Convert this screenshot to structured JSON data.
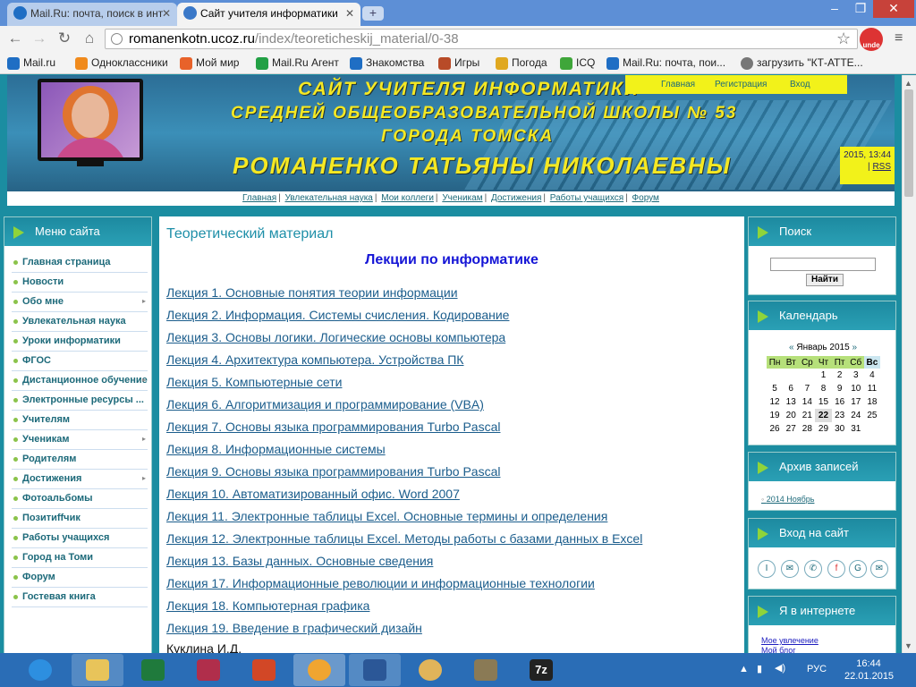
{
  "browser": {
    "tabs": [
      {
        "label": "Mail.Ru: почта, поиск в инт",
        "active": false
      },
      {
        "label": "Сайт учителя информатики",
        "active": true
      }
    ],
    "url_host": "romanenkotn.ucoz.ru",
    "url_path": "/index/teoreticheskij_material/0-38",
    "extension_label": "unde",
    "window_controls": {
      "minimize": "–",
      "restore": "❐",
      "close": "✕"
    }
  },
  "bookmarks": [
    {
      "label": "Mail.ru",
      "icon": "mailru-icon",
      "color": "#1f6ec4"
    },
    {
      "label": "Одноклассники",
      "icon": "odnoklassniki-icon",
      "color": "#f08a1c"
    },
    {
      "label": "Мой мир",
      "icon": "moimir-icon",
      "color": "#e8622a"
    },
    {
      "label": "Mail.Ru Агент",
      "icon": "agent-icon",
      "color": "#22a045"
    },
    {
      "label": "Знакомства",
      "icon": "znakomstva-icon",
      "color": "#1f6ec4"
    },
    {
      "label": "Игры",
      "icon": "games-icon",
      "color": "#b84b28"
    },
    {
      "label": "Погода",
      "icon": "weather-icon",
      "color": "#e0a820"
    },
    {
      "label": "ICQ",
      "icon": "icq-icon",
      "color": "#3fa63a"
    },
    {
      "label": "Mail.Ru: почта, пои...",
      "icon": "mailru-icon",
      "color": "#1f6ec4"
    },
    {
      "label": "загрузить \"КТ-АТТЕ...",
      "icon": "globe-icon",
      "color": "#777777"
    }
  ],
  "banner": {
    "line1": "Сайт учителя информатики",
    "line2": "средней общеобразовательной школы № 53",
    "line3": "города Томска",
    "line4": "Романенко Татьяны Николаевны",
    "top_menu": [
      "Главная",
      "Регистрация",
      "Вход"
    ],
    "date_text": "2015, 13:44",
    "rss": "RSS"
  },
  "navline": [
    "Главная",
    "Увлекательная наука",
    "Мои коллеги",
    "Ученикам",
    "Достижения",
    "Работы учащихся",
    "Форум"
  ],
  "left_menu": {
    "title": "Меню сайта",
    "items": [
      {
        "label": "Главная страница",
        "sub": false
      },
      {
        "label": "Новости",
        "sub": false
      },
      {
        "label": "Обо мне",
        "sub": true
      },
      {
        "label": "Увлекательная наука",
        "sub": false
      },
      {
        "label": "Уроки информатики",
        "sub": false
      },
      {
        "label": "ФГОС",
        "sub": false
      },
      {
        "label": "Дистанционное обучение",
        "sub": true
      },
      {
        "label": "Электронные ресурсы ...",
        "sub": false
      },
      {
        "label": "Учителям",
        "sub": false
      },
      {
        "label": "Ученикам",
        "sub": true
      },
      {
        "label": "Родителям",
        "sub": false
      },
      {
        "label": "Достижения",
        "sub": true
      },
      {
        "label": "Фотоальбомы",
        "sub": false
      },
      {
        "label": "Позитиffчик",
        "sub": false
      },
      {
        "label": "Работы учащихся",
        "sub": false
      },
      {
        "label": "Город на Томи",
        "sub": false
      },
      {
        "label": "Форум",
        "sub": false
      },
      {
        "label": "Гостевая книга",
        "sub": false
      }
    ]
  },
  "content": {
    "title": "Теоретический материал",
    "heading": "Лекции по информатике",
    "lectures": [
      "Лекция 1. Основные понятия теории информации",
      "Лекция 2. Информация. Системы счисления. Кодирование",
      "Лекция 3. Основы логики. Логические основы компьютера",
      "Лекция 4. Архитектура компьютера. Устройства ПК",
      "Лекция 5. Компьютерные сети",
      "Лекция 6. Алгоритмизация и программирование (VBA)",
      "Лекция 7. Основы языка программирования Turbo Pascal",
      "Лекция 8. Информационные системы",
      "Лекция 9. Основы языка программирования Turbo Pascal",
      "Лекция 10. Автоматизированный офис. Word 2007",
      "Лекция 11. Электронные таблицы Excel. Основные термины и определения",
      "Лекция 12. Электронные таблицы Excel. Методы работы с базами данных в Excel",
      "Лекция 13. Базы данных. Основные сведения",
      "Лекция 17. Информационные революции и информационные технологии",
      "Лекция 18. Компьютерная графика",
      "Лекция 19. Введение в графический дизайн"
    ],
    "author_partial": "Куклина И.Д."
  },
  "search": {
    "title": "Поиск",
    "button": "Найти",
    "value": ""
  },
  "calendar": {
    "title": "Календарь",
    "prev": "«",
    "month_label": "Январь 2015",
    "next": "»",
    "weekdays": [
      "Пн",
      "Вт",
      "Ср",
      "Чт",
      "Пт",
      "Сб",
      "Вс"
    ],
    "weeks": [
      [
        "",
        "",
        "",
        "1",
        "2",
        "3",
        "4"
      ],
      [
        "5",
        "6",
        "7",
        "8",
        "9",
        "10",
        "11"
      ],
      [
        "12",
        "13",
        "14",
        "15",
        "16",
        "17",
        "18"
      ],
      [
        "19",
        "20",
        "21",
        "22",
        "23",
        "24",
        "25"
      ],
      [
        "26",
        "27",
        "28",
        "29",
        "30",
        "31",
        ""
      ]
    ],
    "today": "22"
  },
  "archive": {
    "title": "Архив записей",
    "link": "2014 Ноябрь"
  },
  "login": {
    "title": "Вход на сайт",
    "providers": [
      "I",
      "✉",
      "✆",
      "f",
      "G",
      "✉"
    ]
  },
  "internet": {
    "title": "Я в интернете",
    "links": [
      "Мое увлечение",
      "Мой блог"
    ]
  },
  "taskbar": {
    "apps": [
      {
        "name": "ie-icon",
        "color": "#2d8fe0"
      },
      {
        "name": "explorer-icon",
        "color": "#e8c45a"
      },
      {
        "name": "excel-icon",
        "color": "#1f7a3c"
      },
      {
        "name": "access-icon",
        "color": "#b02e4b"
      },
      {
        "name": "powerpoint-icon",
        "color": "#d24726"
      },
      {
        "name": "chrome-icon",
        "color": "#f0a531"
      },
      {
        "name": "word-icon",
        "color": "#2b5797"
      },
      {
        "name": "paint-icon",
        "color": "#e0b45a"
      },
      {
        "name": "gimp-icon",
        "color": "#8a7a55"
      },
      {
        "name": "7zip-icon",
        "color": "#222222"
      }
    ],
    "lang": "РУС",
    "time": "16:44",
    "date": "22.01.2015"
  }
}
